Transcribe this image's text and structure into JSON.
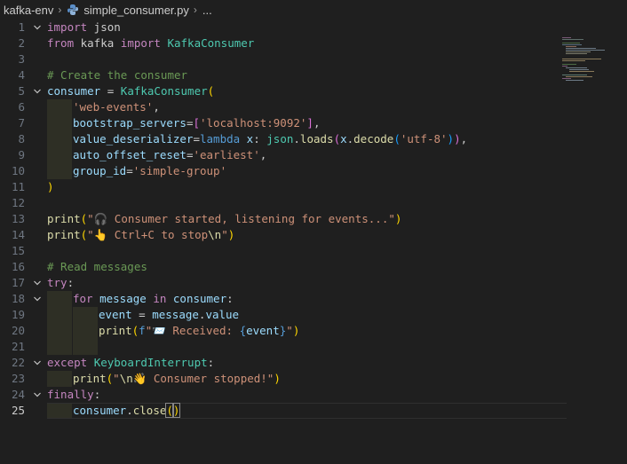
{
  "breadcrumb": {
    "folder": "kafka-env",
    "file": "simple_consumer.py",
    "more": "..."
  },
  "editor": {
    "active_line": 25,
    "lines": [
      {
        "n": "1",
        "fold": true
      },
      {
        "n": "2"
      },
      {
        "n": "3"
      },
      {
        "n": "4"
      },
      {
        "n": "5",
        "fold": true
      },
      {
        "n": "6"
      },
      {
        "n": "7"
      },
      {
        "n": "8"
      },
      {
        "n": "9"
      },
      {
        "n": "10"
      },
      {
        "n": "11"
      },
      {
        "n": "12"
      },
      {
        "n": "13"
      },
      {
        "n": "14"
      },
      {
        "n": "15"
      },
      {
        "n": "16"
      },
      {
        "n": "17",
        "fold": true
      },
      {
        "n": "18",
        "fold": true
      },
      {
        "n": "19"
      },
      {
        "n": "20"
      },
      {
        "n": "21"
      },
      {
        "n": "22",
        "fold": true
      },
      {
        "n": "23"
      },
      {
        "n": "24",
        "fold": true
      },
      {
        "n": "25"
      }
    ],
    "tokens": {
      "l1": [
        "import",
        " json"
      ],
      "l2": [
        "from",
        " kafka ",
        "import",
        " KafkaConsumer"
      ],
      "l4": "# Create the consumer",
      "l5": [
        "consumer",
        " = ",
        "KafkaConsumer",
        "("
      ],
      "l6": [
        "'web-events'",
        ","
      ],
      "l7": [
        "bootstrap_servers",
        "=",
        "[",
        "'localhost:9092'",
        "]",
        ","
      ],
      "l8": [
        "value_deserializer",
        "=",
        "lambda",
        " x",
        ": ",
        "json",
        ".",
        "loads",
        "(",
        "x",
        ".",
        "decode",
        "(",
        "'utf-8'",
        ")",
        ")",
        ","
      ],
      "l9": [
        "auto_offset_reset",
        "=",
        "'earliest'",
        ","
      ],
      "l10": [
        "group_id",
        "=",
        "'simple-group'"
      ],
      "l11": ")",
      "l13": [
        "print",
        "(",
        "\"🎧 Consumer started, listening for events...\"",
        ")"
      ],
      "l14": [
        "print",
        "(",
        "\"👆 Ctrl+C to stop",
        "\\n",
        "\"",
        ")"
      ],
      "l16": "# Read messages",
      "l17": [
        "try",
        ":"
      ],
      "l18": [
        "for",
        " message ",
        "in",
        " consumer",
        ":"
      ],
      "l19": [
        "event",
        " = ",
        "message",
        ".",
        "value"
      ],
      "l20": [
        "print",
        "(",
        "f",
        "\"📨 Received: ",
        "{",
        "event",
        "}",
        "\"",
        ")"
      ],
      "l22": [
        "except",
        " ",
        "KeyboardInterrupt",
        ":"
      ],
      "l23": [
        "print",
        "(",
        "\"",
        "\\n",
        "👋 Consumer stopped!\"",
        ")"
      ],
      "l24": [
        "finally",
        ":"
      ],
      "l25": [
        "consumer",
        ".",
        "close",
        "(",
        ")"
      ]
    }
  },
  "colors": {
    "background": "#1f1f1f",
    "keyword": "#c586c0",
    "variable": "#9cdcfe",
    "class": "#4ec9b0",
    "function": "#dcdcaa",
    "string": "#ce9178",
    "comment": "#6a9955",
    "bracket_gold": "#ffd700",
    "bracket_purple": "#da70d6"
  },
  "icons": {
    "file_icon": "python-file-icon",
    "fold_icon": "chevron-down-icon",
    "separator_icon": "chevron-right-icon"
  }
}
